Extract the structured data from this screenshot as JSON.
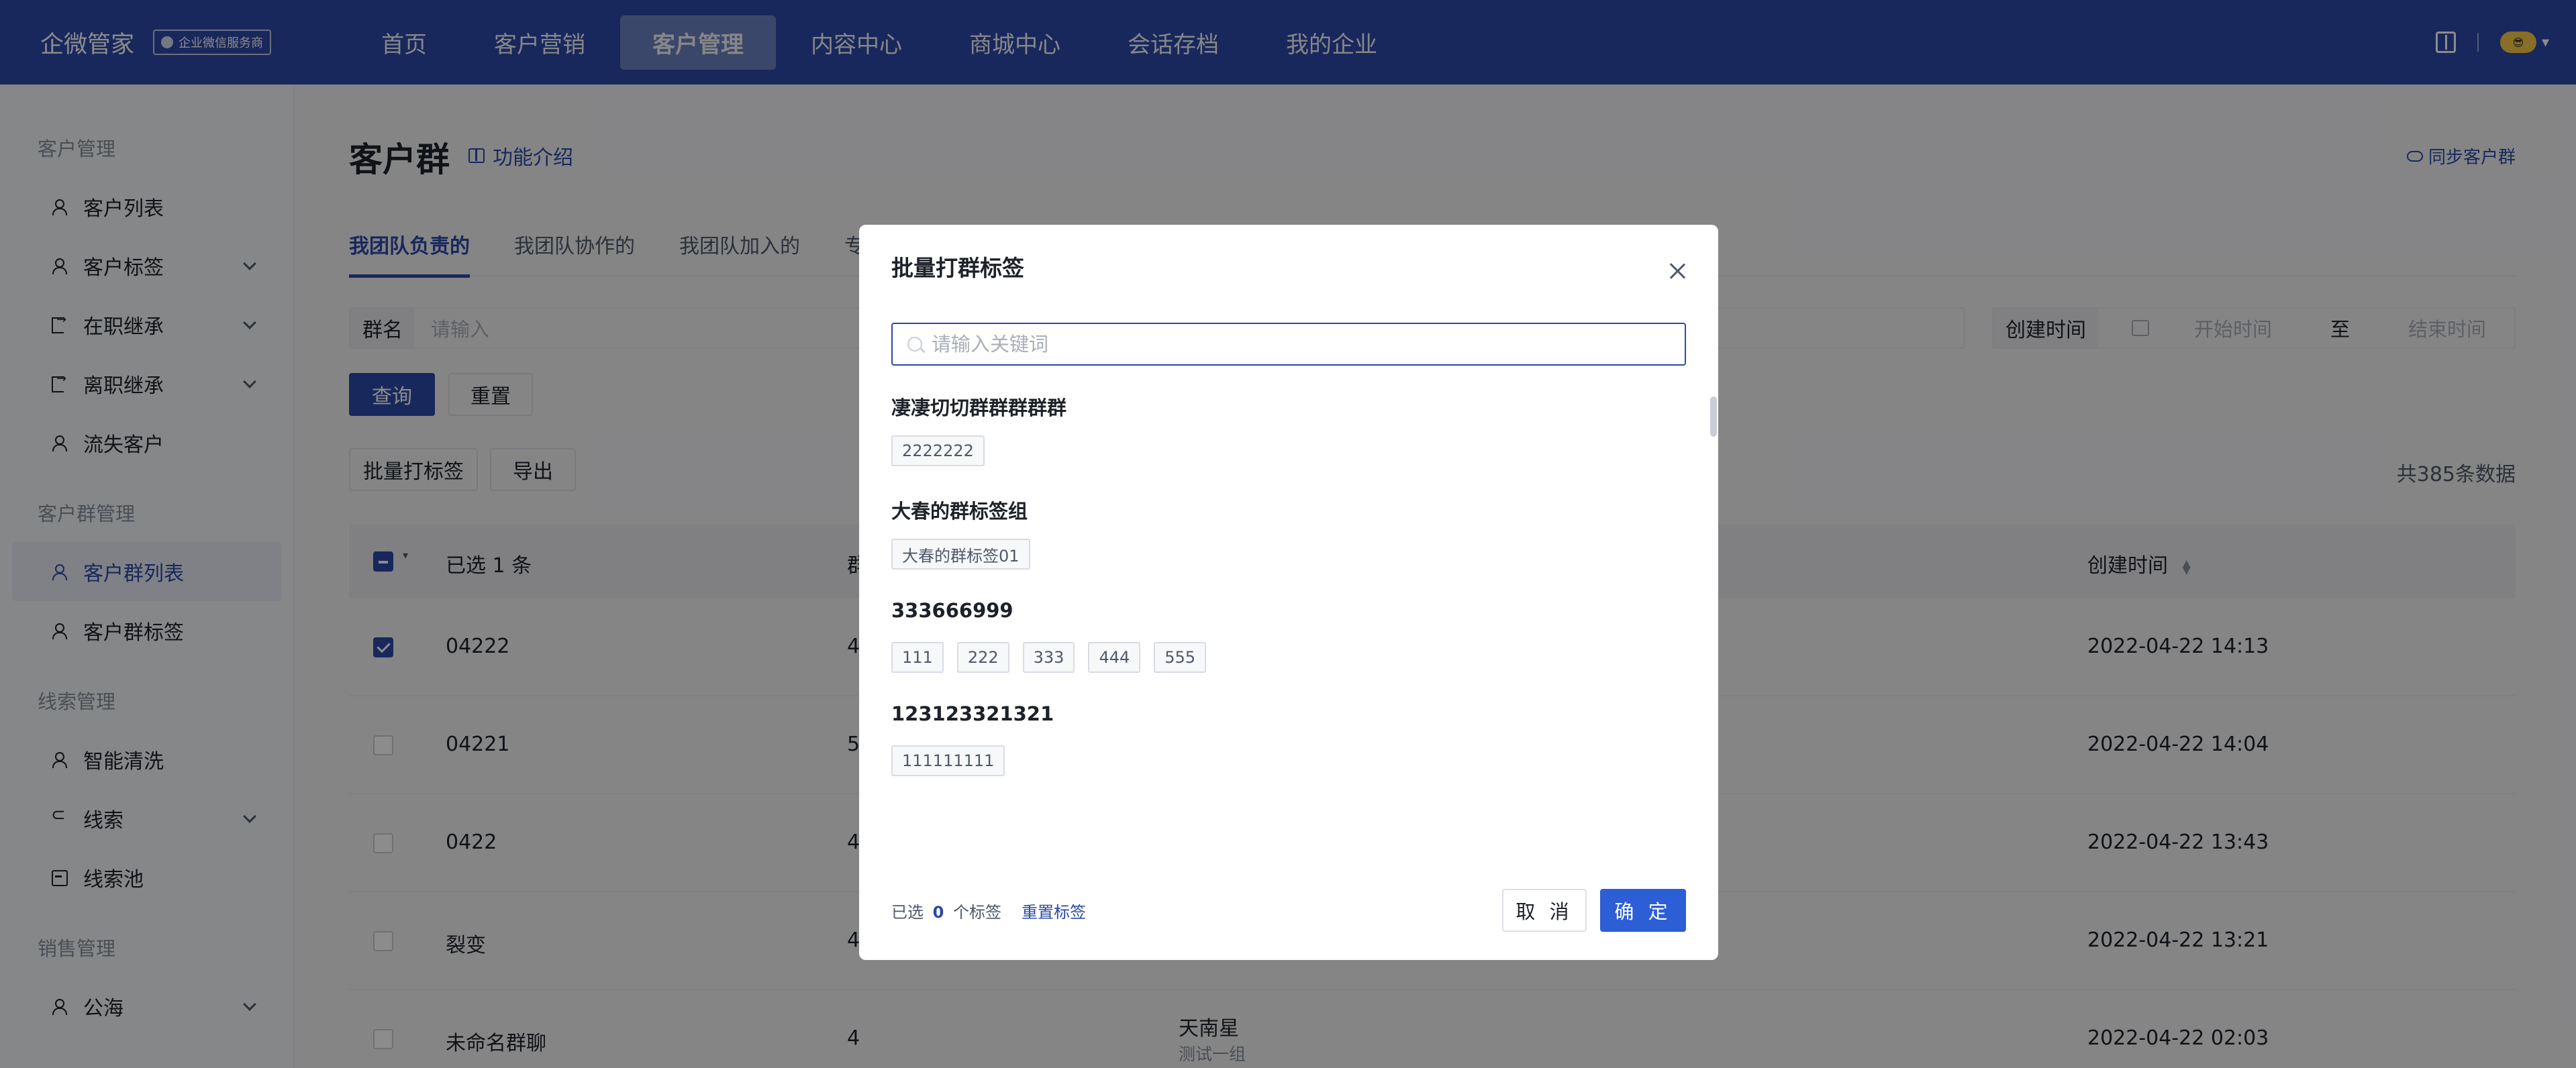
{
  "topbar": {
    "brand": "企微管家",
    "badge": "企业微信服务商",
    "nav": [
      "首页",
      "客户营销",
      "客户管理",
      "内容中心",
      "商城中心",
      "会话存档",
      "我的企业"
    ],
    "active_nav": "客户管理",
    "right_icons": [
      "book-icon",
      "avatar"
    ]
  },
  "sidebar": {
    "groups": [
      {
        "title": "客户管理",
        "items": [
          {
            "label": "客户列表",
            "icon": "user-icon",
            "expandable": false
          },
          {
            "label": "客户标签",
            "icon": "user-icon",
            "expandable": true
          },
          {
            "label": "在职继承",
            "icon": "door-icon",
            "expandable": true
          },
          {
            "label": "离职继承",
            "icon": "door-icon",
            "expandable": true
          },
          {
            "label": "流失客户",
            "icon": "user-icon",
            "expandable": false
          }
        ]
      },
      {
        "title": "客户群管理",
        "items": [
          {
            "label": "客户群列表",
            "icon": "group-icon",
            "expandable": false,
            "active": true
          },
          {
            "label": "客户群标签",
            "icon": "group-icon",
            "expandable": false
          }
        ]
      },
      {
        "title": "线索管理",
        "items": [
          {
            "label": "智能清洗",
            "icon": "user-icon",
            "expandable": false
          },
          {
            "label": "线索",
            "icon": "link-icon",
            "expandable": true
          },
          {
            "label": "线索池",
            "icon": "box-icon",
            "expandable": false
          }
        ]
      },
      {
        "title": "销售管理",
        "items": [
          {
            "label": "公海",
            "icon": "user-icon",
            "expandable": true
          }
        ]
      }
    ]
  },
  "main": {
    "title": "客户群",
    "func_intro": "功能介绍",
    "sync": "同步客户群",
    "tabs": [
      "我团队负责的",
      "我团队协作的",
      "我团队加入的",
      "专属"
    ],
    "active_tab": 0,
    "filters": {
      "group_name_label": "群名",
      "group_name_placeholder": "请输入",
      "created_label": "创建时间",
      "start_placeholder": "开始时间",
      "to": "至",
      "end_placeholder": "结束时间"
    },
    "query_button": "查询",
    "reset_button": "重置",
    "batch_tag_button": "批量打标签",
    "export_button": "导出",
    "total": "共385条数据",
    "table": {
      "selected_header": "已选 1 条",
      "col_count_header": "群",
      "created_header": "创建时间",
      "rows": [
        {
          "name": "04222",
          "count": "4",
          "owner": "",
          "owner_sub": "",
          "created": "2022-04-22 14:13",
          "checked": true
        },
        {
          "name": "04221",
          "count": "5",
          "owner": "",
          "owner_sub": "",
          "created": "2022-04-22 14:04",
          "checked": false
        },
        {
          "name": "0422",
          "count": "4",
          "owner": "",
          "owner_sub": "",
          "created": "2022-04-22 13:43",
          "checked": false
        },
        {
          "name": "裂变",
          "count": "4",
          "owner": "",
          "owner_sub": "",
          "created": "2022-04-22 13:21",
          "checked": false
        },
        {
          "name": "未命名群聊",
          "count": "4",
          "owner": "天南星",
          "owner_sub": "测试一组",
          "created": "2022-04-22 02:03",
          "checked": false
        }
      ]
    }
  },
  "modal": {
    "title": "批量打群标签",
    "search_placeholder": "请输入关键词",
    "search_value": "",
    "groups": [
      {
        "name": "凄凄切切群群群群群",
        "tags": [
          "2222222"
        ]
      },
      {
        "name": "大春的群标签组",
        "tags": [
          "大春的群标签01"
        ]
      },
      {
        "name": "333666999",
        "tags": [
          "111",
          "222",
          "333",
          "444",
          "555"
        ]
      },
      {
        "name": "123123321321",
        "tags": [
          "111111111"
        ]
      }
    ],
    "selected_prefix": "已选",
    "selected_count": "0",
    "selected_suffix": "个标签",
    "reset_tags": "重置标签",
    "cancel": "取 消",
    "confirm": "确 定"
  },
  "colors": {
    "primary": "#2c4aa8",
    "confirm_button": "#2c5ed6",
    "overlay": "rgba(0,0,0,0.45)"
  }
}
